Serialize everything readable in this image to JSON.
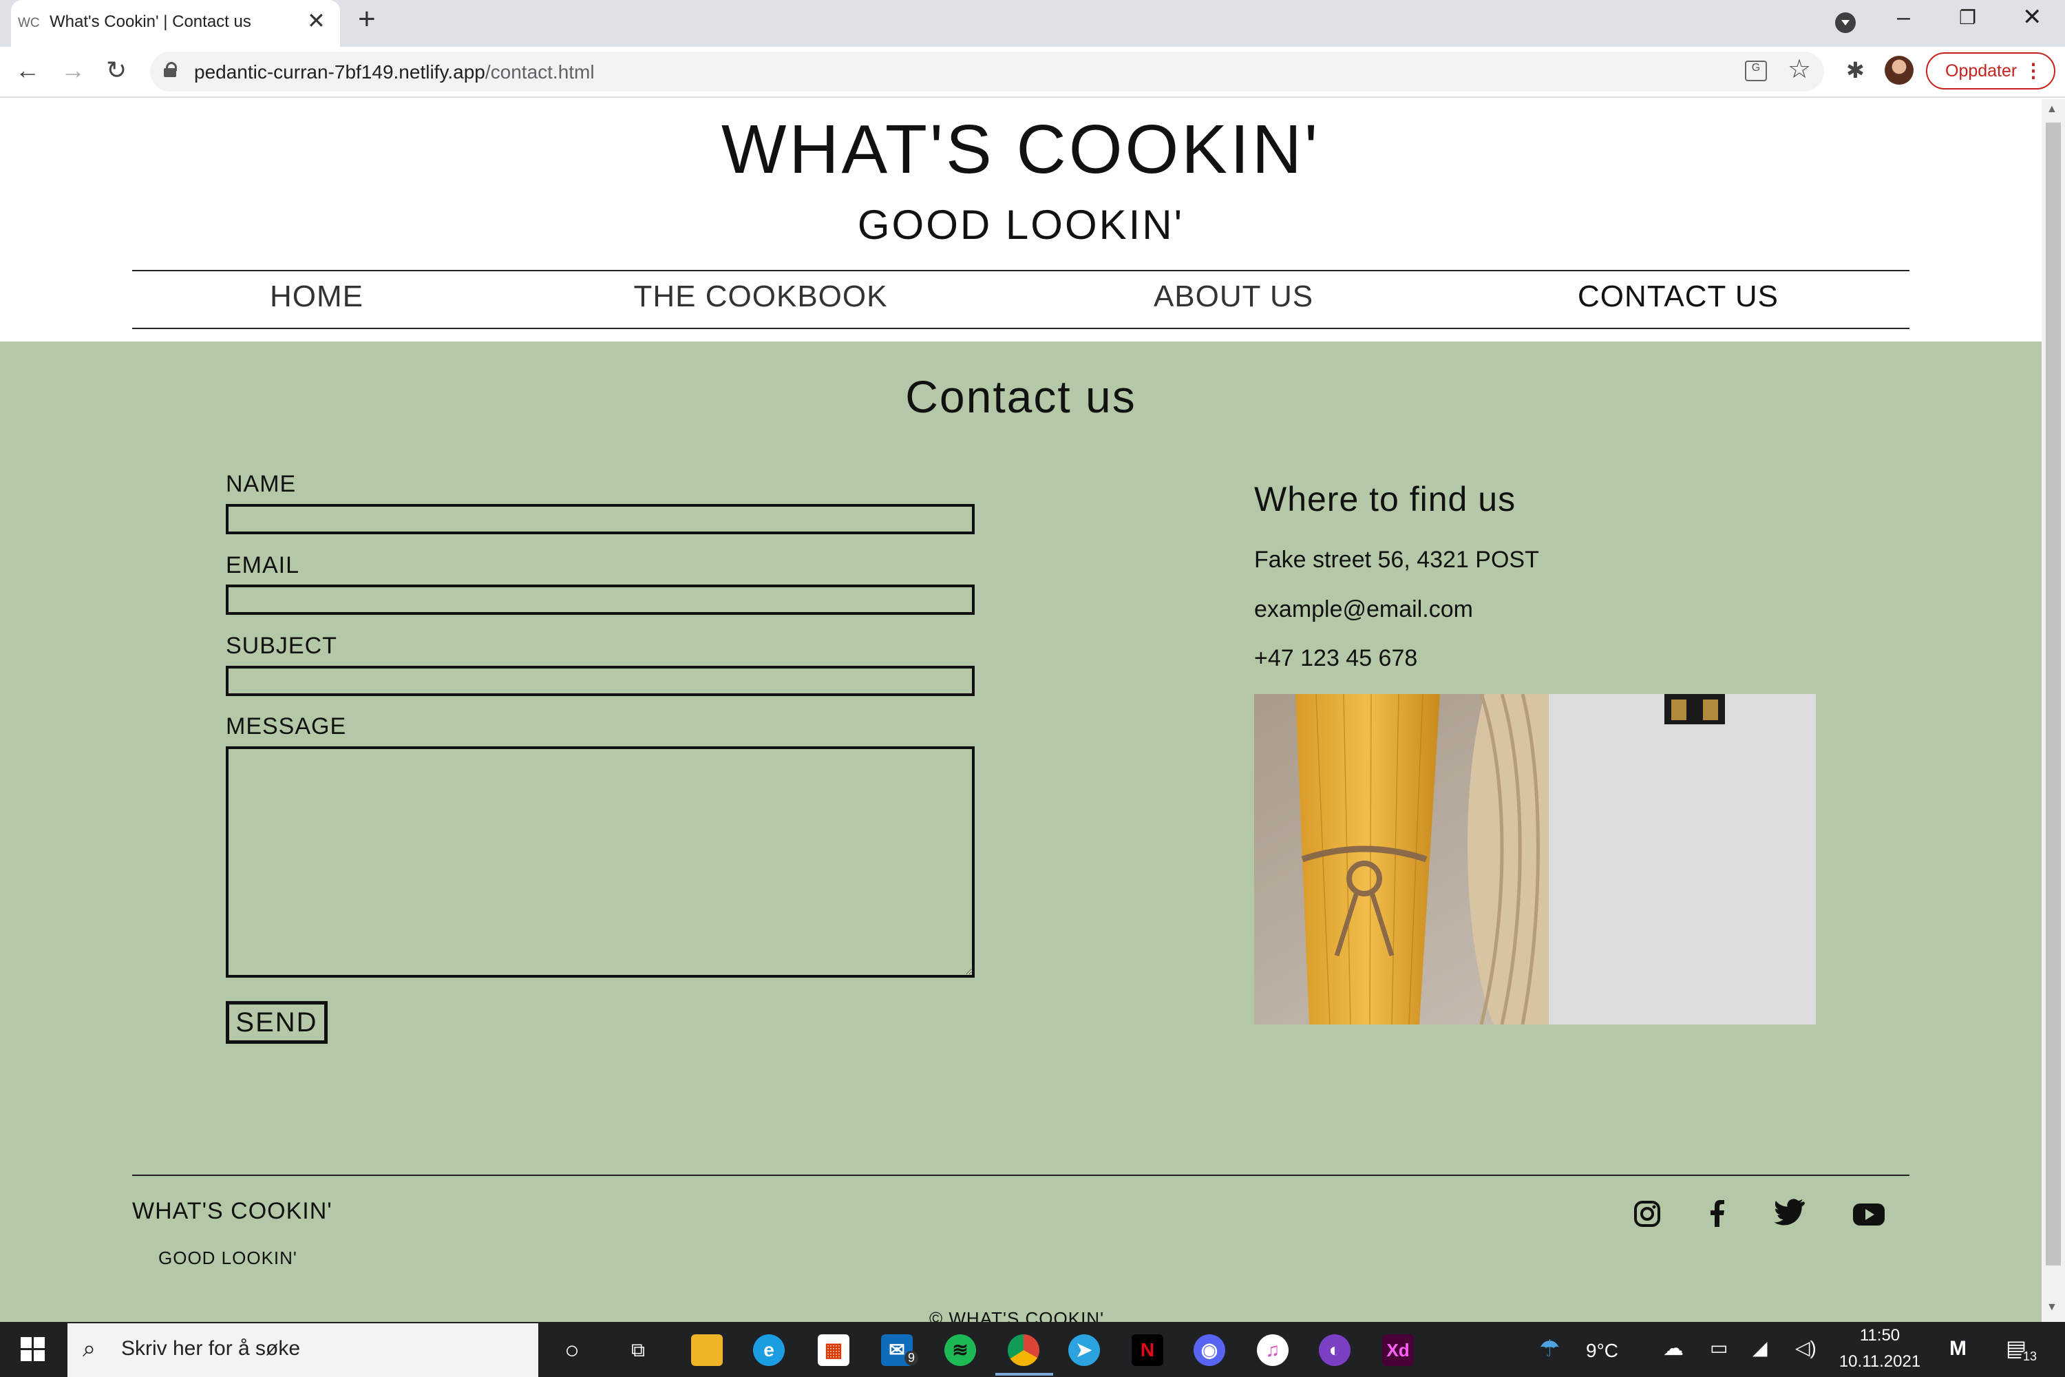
{
  "browser": {
    "tab_favicon": "WC",
    "tab_title": "What's Cookin' | Contact us",
    "url_host": "pedantic-curran-7bf149.netlify.app",
    "url_path": "/contact.html",
    "update_label": "Oppdater"
  },
  "site": {
    "title": "WHAT'S COOKIN'",
    "subtitle": "GOOD LOOKIN'",
    "nav": [
      "HOME",
      "THE COOKBOOK",
      "ABOUT US",
      "CONTACT US"
    ],
    "active_nav": "CONTACT US"
  },
  "contact": {
    "heading": "Contact us",
    "form": {
      "name_label": "NAME",
      "email_label": "EMAIL",
      "subject_label": "SUBJECT",
      "message_label": "MESSAGE",
      "name_value": "",
      "email_value": "",
      "subject_value": "",
      "message_value": "",
      "send_label": "SEND"
    },
    "find_us": {
      "heading": "Where to find us",
      "address": "Fake street 56, 4321 POST",
      "email": "example@email.com",
      "phone": "+47 123 45 678"
    }
  },
  "footer": {
    "title": "WHAT'S COOKIN'",
    "subtitle": "GOOD LOOKIN'",
    "copyright": "© WHAT'S COOKIN'",
    "social_icons": [
      "instagram-icon",
      "facebook-icon",
      "twitter-icon",
      "youtube-icon"
    ]
  },
  "taskbar": {
    "search_placeholder": "Skriv her for å søke",
    "mail_badge": "9",
    "temperature": "9°C",
    "time": "11:50",
    "date": "10.11.2021",
    "notification_count": "13",
    "pinned_apps": [
      "cortana-icon",
      "task-view-icon",
      "file-explorer-icon",
      "edge-icon",
      "store-icon",
      "mail-icon",
      "spotify-icon",
      "chrome-icon",
      "telegram-icon",
      "netflix-icon",
      "discord-icon",
      "itunes-icon",
      "github-icon",
      "adobe-xd-icon"
    ]
  },
  "colors": {
    "page_green": "#b4c7a6",
    "taskbar": "#202124",
    "update_red": "#c5221f"
  }
}
